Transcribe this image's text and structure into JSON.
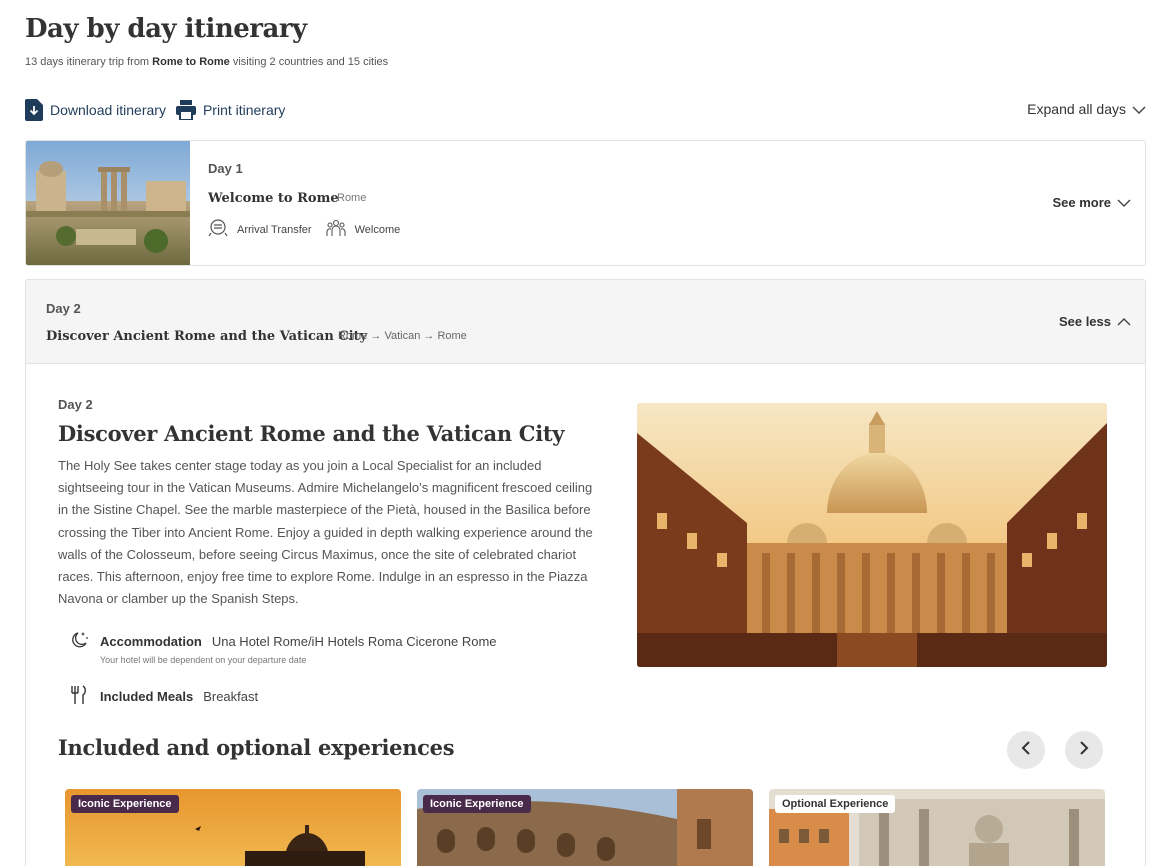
{
  "header": {
    "title": "Day by day itinerary",
    "subtitle_prefix": "13 days itinerary trip from ",
    "subtitle_route": "Rome to Rome",
    "subtitle_suffix": " visiting 2 countries and 15 cities"
  },
  "actions": {
    "download": "Download itinerary",
    "print": "Print itinerary",
    "expand_all": "Expand all days"
  },
  "day1": {
    "label": "Day 1",
    "title": "Welcome to Rome",
    "location": "Rome",
    "tags": [
      "Arrival Transfer",
      "Welcome"
    ],
    "toggle": "See more"
  },
  "day2": {
    "label": "Day 2",
    "title": "Discover Ancient Rome and the Vatican City",
    "route": "Rome → Vatican → Rome",
    "toggle": "See less",
    "detail_label": "Day 2",
    "detail_title": "Discover Ancient Rome and the Vatican City",
    "description": "The Holy See takes center stage today as you join a Local Specialist for an included sightseeing tour in the Vatican Museums. Admire Michelangelo’s magnificent frescoed ceiling in the Sistine Chapel. See the marble masterpiece of the Pietà, housed in the Basilica before crossing the Tiber into Ancient Rome. Enjoy a guided in depth walking experience around the walls of the Colosseum, before seeing Circus Maximus, once the site of celebrated chariot races. This afternoon, enjoy free time to explore Rome. Indulge in an espresso in the Piazza Navona or clamber up the Spanish Steps.",
    "accommodation_label": "Accommodation",
    "accommodation_value": "Una Hotel Rome/iH Hotels Roma Cicerone Rome",
    "accommodation_note": "Your hotel will be dependent on your departure date",
    "meals_label": "Included Meals",
    "meals_value": "Breakfast",
    "experiences_title": "Included and optional experiences",
    "experiences": [
      {
        "badge": "Iconic Experience"
      },
      {
        "badge": "Iconic Experience"
      },
      {
        "badge": "Optional Experience"
      }
    ]
  },
  "colors": {
    "link": "#1f3c5a",
    "iconic_badge": "#4a2a4a",
    "panel_bg": "#f5f5f5"
  }
}
